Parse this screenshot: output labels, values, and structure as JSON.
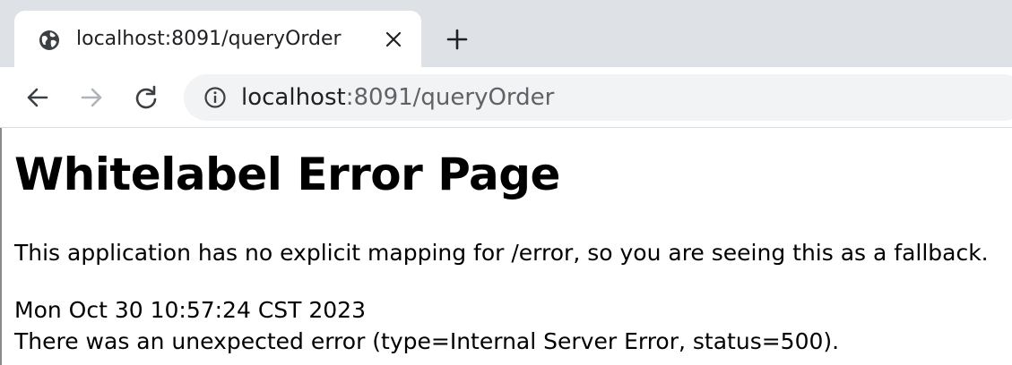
{
  "browser": {
    "tab": {
      "title": "localhost:8091/queryOrder",
      "icon": "globe-icon",
      "close_icon": "close-icon"
    },
    "new_tab_icon": "plus-icon",
    "toolbar": {
      "back_icon": "arrow-left-icon",
      "forward_icon": "arrow-right-icon",
      "reload_icon": "reload-icon",
      "site_info_icon": "info-icon",
      "url_host": "localhost",
      "url_rest": ":8091/queryOrder"
    }
  },
  "page": {
    "heading": "Whitelabel Error Page",
    "message": "This application has no explicit mapping for /error, so you are seeing this as a fallback.",
    "timestamp": "Mon Oct 30 10:57:24 CST 2023",
    "error_detail": "There was an unexpected error (type=Internal Server Error, status=500)."
  },
  "colors": {
    "tabstrip": "#dee1e6",
    "omnibox": "#f1f3f4",
    "icon": "#3c4043",
    "icon_disabled": "#b0b3b8"
  }
}
